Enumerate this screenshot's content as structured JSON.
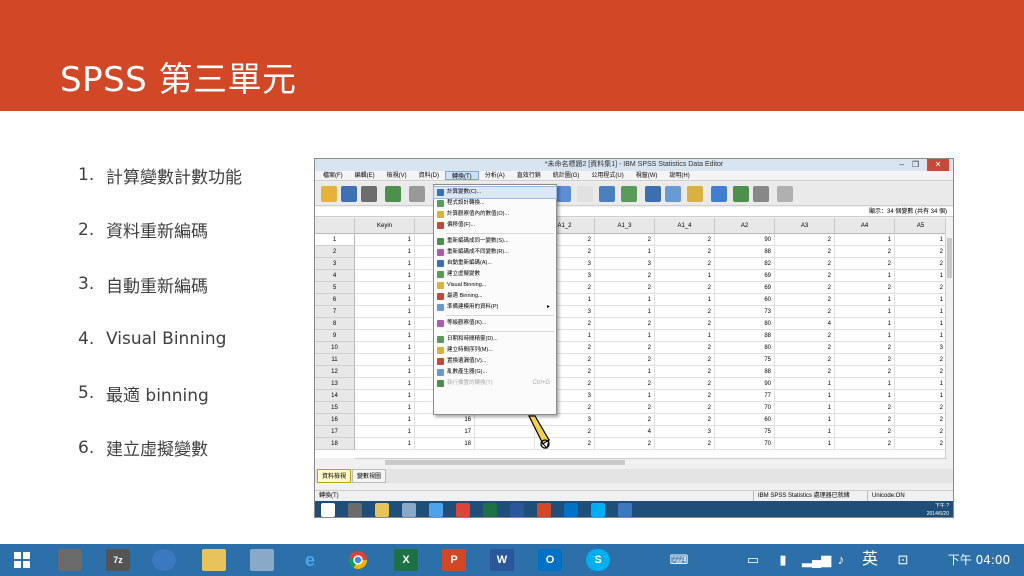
{
  "slide": {
    "title": "SPSS 第三單元",
    "bullets": [
      {
        "num": "1.",
        "text": "計算變數計數功能"
      },
      {
        "num": "2.",
        "text": "資料重新編碼"
      },
      {
        "num": "3.",
        "text": "自動重新編碼"
      },
      {
        "num": "4.",
        "text": "Visual Binning"
      },
      {
        "num": "5.",
        "text": "最適 binning"
      },
      {
        "num": "6.",
        "text": "建立虛擬變數"
      }
    ]
  },
  "spss": {
    "window_title": "*未命名標題2 [資料集1] - IBM SPSS Statistics Data Editor",
    "window_controls": [
      "–",
      "❐",
      "✕"
    ],
    "menus": [
      "檔案(F)",
      "編輯(E)",
      "檢視(V)",
      "資料(D)",
      "轉換(T)",
      "分析(A)",
      "直效行銷",
      "統計圖(G)",
      "公用程式(U)",
      "視窗(W)",
      "說明(H)"
    ],
    "active_menu": 4,
    "visible_vars": "顯示：34 個變數 (共有 34 個)",
    "columns": [
      "Keyin",
      "st",
      "",
      "A1_2",
      "A1_3",
      "A1_4",
      "A2",
      "A3",
      "A4",
      "A5"
    ],
    "rows": [
      {
        "n": "1",
        "keyin": "1",
        "a12": "2",
        "a13": "2",
        "a14": "2",
        "a2": "90",
        "a3": "2",
        "a4": "1",
        "a5": "1"
      },
      {
        "n": "2",
        "keyin": "1",
        "a12": "2",
        "a13": "1",
        "a14": "2",
        "a2": "88",
        "a3": "2",
        "a4": "2",
        "a5": "2"
      },
      {
        "n": "3",
        "keyin": "1",
        "a12": "3",
        "a13": "3",
        "a14": "2",
        "a2": "82",
        "a3": "2",
        "a4": "2",
        "a5": "2"
      },
      {
        "n": "4",
        "keyin": "1",
        "a12": "3",
        "a13": "2",
        "a14": "1",
        "a2": "69",
        "a3": "2",
        "a4": "1",
        "a5": "1"
      },
      {
        "n": "5",
        "keyin": "1",
        "a12": "2",
        "a13": "2",
        "a14": "2",
        "a2": "69",
        "a3": "2",
        "a4": "2",
        "a5": "2"
      },
      {
        "n": "6",
        "keyin": "1",
        "a12": "1",
        "a13": "1",
        "a14": "1",
        "a2": "60",
        "a3": "2",
        "a4": "1",
        "a5": "1"
      },
      {
        "n": "7",
        "keyin": "1",
        "a12": "3",
        "a13": "1",
        "a14": "2",
        "a2": "73",
        "a3": "2",
        "a4": "1",
        "a5": "1"
      },
      {
        "n": "8",
        "keyin": "1",
        "a12": "2",
        "a13": "2",
        "a14": "2",
        "a2": "80",
        "a3": "4",
        "a4": "1",
        "a5": "1"
      },
      {
        "n": "9",
        "keyin": "1",
        "a12": "1",
        "a13": "1",
        "a14": "1",
        "a2": "88",
        "a3": "2",
        "a4": "1",
        "a5": "1"
      },
      {
        "n": "10",
        "keyin": "1",
        "a12": "2",
        "a13": "2",
        "a14": "2",
        "a2": "80",
        "a3": "2",
        "a4": "2",
        "a5": "3"
      },
      {
        "n": "11",
        "keyin": "1",
        "a12": "2",
        "a13": "2",
        "a14": "2",
        "a2": "75",
        "a3": "2",
        "a4": "2",
        "a5": "2"
      },
      {
        "n": "12",
        "keyin": "1",
        "a12": "2",
        "a13": "1",
        "a14": "2",
        "a2": "88",
        "a3": "2",
        "a4": "2",
        "a5": "2"
      },
      {
        "n": "13",
        "keyin": "1",
        "a12": "2",
        "a13": "2",
        "a14": "2",
        "a2": "90",
        "a3": "1",
        "a4": "1",
        "a5": "1"
      },
      {
        "n": "14",
        "keyin": "1",
        "a12": "3",
        "a13": "1",
        "a14": "2",
        "a2": "77",
        "a3": "1",
        "a4": "1",
        "a5": "1"
      },
      {
        "n": "15",
        "keyin": "1",
        "a12": "2",
        "a13": "2",
        "a14": "2",
        "a2": "70",
        "a3": "1",
        "a4": "2",
        "a5": "2"
      },
      {
        "n": "16",
        "keyin": "1",
        "st": "16",
        "a12": "3",
        "a13": "2",
        "a14": "2",
        "a2": "60",
        "a3": "1",
        "a4": "2",
        "a5": "2"
      },
      {
        "n": "17",
        "keyin": "1",
        "st": "17",
        "a12": "2",
        "a13": "4",
        "a14": "3",
        "a2": "75",
        "a3": "1",
        "a4": "2",
        "a5": "2"
      },
      {
        "n": "18",
        "keyin": "1",
        "st": "18",
        "a12": "2",
        "a13": "2",
        "a14": "2",
        "a2": "70",
        "a3": "1",
        "a4": "2",
        "a5": "2"
      }
    ],
    "view_tabs": [
      "資料檢視",
      "變數視圖"
    ],
    "status_left": "轉換(T)",
    "status_mid": "IBM SPSS Statistics 處理器已就緒",
    "status_right": "Unicode:ON",
    "inner_clock": [
      "下午 ?",
      "2014/6/20"
    ],
    "dropdown": [
      {
        "label": "計算變數(C)..."
      },
      {
        "label": "程式設計轉換..."
      },
      {
        "label": "計算觀察值內的數值(O)..."
      },
      {
        "label": "偏移值(F)..."
      },
      {
        "sep": true
      },
      {
        "label": "重新編碼成同一變數(S)..."
      },
      {
        "label": "重新編碼成不同變數(R)..."
      },
      {
        "label": "自動重新編碼(A)..."
      },
      {
        "label": "建立虛擬變數"
      },
      {
        "label": "Visual Binning..."
      },
      {
        "label": "最適 Binning..."
      },
      {
        "label": "準備建模用的資料(P)",
        "arrow": "▸"
      },
      {
        "sep": true
      },
      {
        "label": "等級觀察值(K)..."
      },
      {
        "sep": true
      },
      {
        "label": "日期和時間精靈(D)..."
      },
      {
        "label": "建立時間序列(M)..."
      },
      {
        "label": "置換遺漏值(V)..."
      },
      {
        "label": "亂數產生器(G)..."
      },
      {
        "label": "執行擱置的轉換(T)",
        "shortcut": "Ctrl+G"
      }
    ]
  },
  "taskbar": {
    "clock": "下午 04:00",
    "ime": "英",
    "colors": {
      "title_bg": "#d24726",
      "taskbar_bg": "#2d6fa8"
    }
  }
}
